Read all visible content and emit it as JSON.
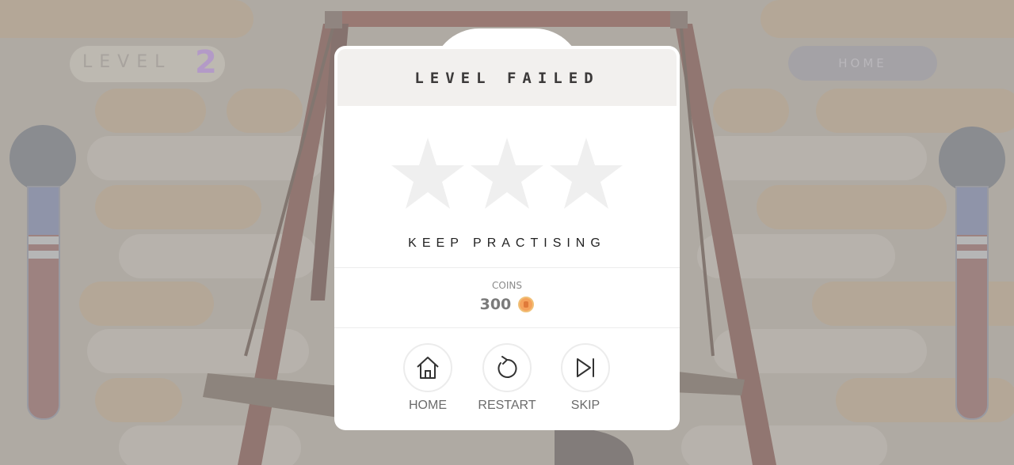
{
  "hud": {
    "level_label": "LEVEL",
    "level_number": "2",
    "home_label": "HOME"
  },
  "modal": {
    "title": "LEVEL FAILED",
    "stars_earned": 0,
    "stars_total": 3,
    "subtitle": "KEEP PRACTISING",
    "coins_label": "COINS",
    "coins_value": "300",
    "coin_icon": "coin-icon"
  },
  "actions": [
    {
      "label": "HOME",
      "icon": "home-icon"
    },
    {
      "label": "RESTART",
      "icon": "restart-icon"
    },
    {
      "label": "SKIP",
      "icon": "skip-icon"
    }
  ],
  "colors": {
    "level_number": "#b39ac7",
    "coin": "#f5a25b",
    "star_empty": "#efefef"
  }
}
